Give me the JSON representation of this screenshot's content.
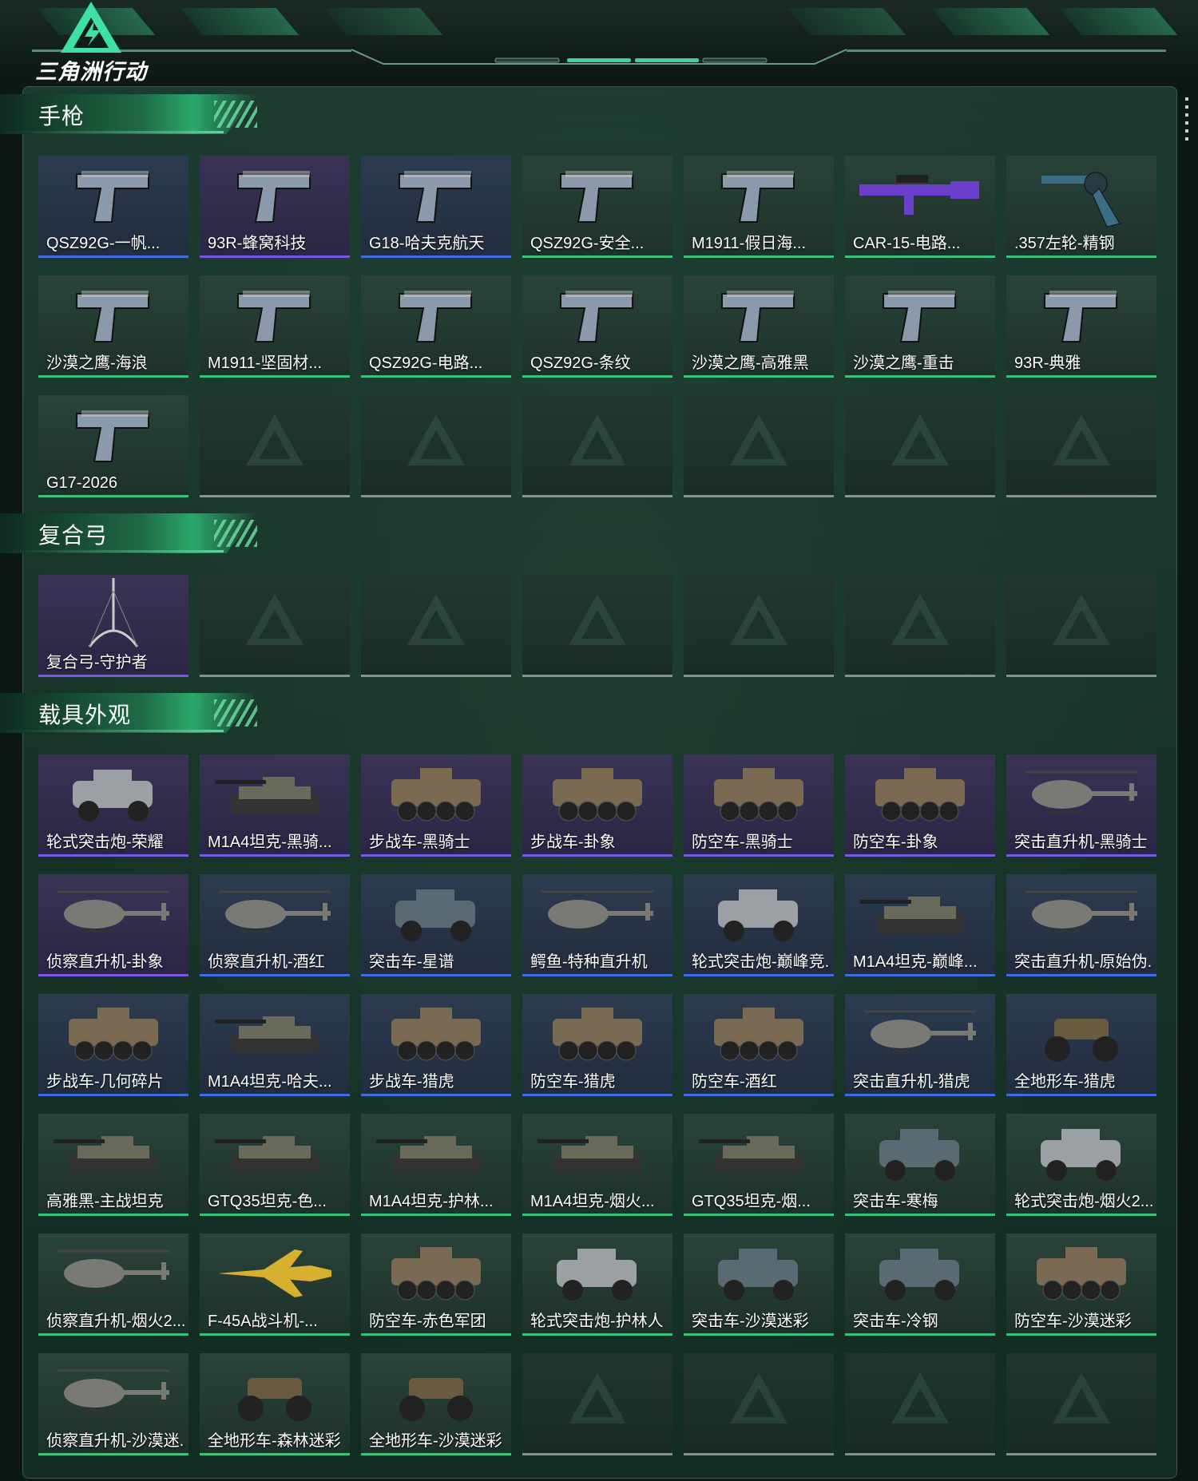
{
  "header": {
    "logo_text": "三角洲行动"
  },
  "colors": {
    "purple": "#7a56e6",
    "blue": "#3d6de0",
    "green": "#37c47a",
    "empty": "#9aa39f"
  },
  "sections": [
    {
      "title": "手枪",
      "items": [
        {
          "name": "QSZ92G-一帆...",
          "rarity": "blue",
          "icon": "pistol-icon"
        },
        {
          "name": "93R-蜂窝科技",
          "rarity": "purple",
          "icon": "pistol-icon"
        },
        {
          "name": "G18-哈夫克航天",
          "rarity": "blue",
          "icon": "pistol-icon"
        },
        {
          "name": "QSZ92G-安全...",
          "rarity": "green",
          "icon": "pistol-icon"
        },
        {
          "name": "M1911-假日海...",
          "rarity": "green",
          "icon": "pistol-icon"
        },
        {
          "name": "CAR-15-电路...",
          "rarity": "green",
          "icon": "rifle-icon"
        },
        {
          "name": ".357左轮-精钢",
          "rarity": "green",
          "icon": "revolver-icon"
        },
        {
          "name": "沙漠之鹰-海浪",
          "rarity": "green",
          "icon": "pistol-icon"
        },
        {
          "name": "M1911-坚固材...",
          "rarity": "green",
          "icon": "pistol-icon"
        },
        {
          "name": "QSZ92G-电路...",
          "rarity": "green",
          "icon": "pistol-icon"
        },
        {
          "name": "QSZ92G-条纹",
          "rarity": "green",
          "icon": "pistol-icon"
        },
        {
          "name": "沙漠之鹰-高雅黑",
          "rarity": "green",
          "icon": "pistol-icon"
        },
        {
          "name": "沙漠之鹰-重击",
          "rarity": "green",
          "icon": "pistol-icon"
        },
        {
          "name": "93R-典雅",
          "rarity": "green",
          "icon": "pistol-icon"
        },
        {
          "name": "G17-2026",
          "rarity": "green",
          "icon": "pistol-icon"
        },
        {
          "name": "",
          "rarity": "empty"
        },
        {
          "name": "",
          "rarity": "empty"
        },
        {
          "name": "",
          "rarity": "empty"
        },
        {
          "name": "",
          "rarity": "empty"
        },
        {
          "name": "",
          "rarity": "empty"
        },
        {
          "name": "",
          "rarity": "empty"
        }
      ]
    },
    {
      "title": "复合弓",
      "items": [
        {
          "name": "复合弓-守护者",
          "rarity": "purple",
          "icon": "bow-icon"
        },
        {
          "name": "",
          "rarity": "empty"
        },
        {
          "name": "",
          "rarity": "empty"
        },
        {
          "name": "",
          "rarity": "empty"
        },
        {
          "name": "",
          "rarity": "empty"
        },
        {
          "name": "",
          "rarity": "empty"
        },
        {
          "name": "",
          "rarity": "empty"
        }
      ]
    },
    {
      "title": "载具外观",
      "items": [
        {
          "name": "轮式突击炮-荣耀",
          "rarity": "purple",
          "icon": "buggy-icon"
        },
        {
          "name": "M1A4坦克-黑骑...",
          "rarity": "purple",
          "icon": "tank-icon"
        },
        {
          "name": "步战车-黑骑士",
          "rarity": "purple",
          "icon": "apc-icon"
        },
        {
          "name": "步战车-卦象",
          "rarity": "purple",
          "icon": "apc-icon"
        },
        {
          "name": "防空车-黑骑士",
          "rarity": "purple",
          "icon": "apc-icon"
        },
        {
          "name": "防空车-卦象",
          "rarity": "purple",
          "icon": "apc-icon"
        },
        {
          "name": "突击直升机-黑骑士",
          "rarity": "purple",
          "icon": "helicopter-icon"
        },
        {
          "name": "侦察直升机-卦象",
          "rarity": "purple",
          "icon": "helicopter-icon"
        },
        {
          "name": "侦察直升机-酒红",
          "rarity": "blue",
          "icon": "helicopter-icon"
        },
        {
          "name": "突击车-星谱",
          "rarity": "blue",
          "icon": "truck-icon"
        },
        {
          "name": "鳄鱼-特种直升机",
          "rarity": "blue",
          "icon": "helicopter-icon"
        },
        {
          "name": "轮式突击炮-巅峰竞...",
          "rarity": "blue",
          "icon": "buggy-icon"
        },
        {
          "name": "M1A4坦克-巅峰...",
          "rarity": "blue",
          "icon": "tank-icon"
        },
        {
          "name": "突击直升机-原始伪...",
          "rarity": "blue",
          "icon": "helicopter-icon"
        },
        {
          "name": "步战车-几何碎片",
          "rarity": "blue",
          "icon": "apc-icon"
        },
        {
          "name": "M1A4坦克-哈夫...",
          "rarity": "blue",
          "icon": "tank-icon"
        },
        {
          "name": "步战车-猎虎",
          "rarity": "blue",
          "icon": "apc-icon"
        },
        {
          "name": "防空车-猎虎",
          "rarity": "blue",
          "icon": "apc-icon"
        },
        {
          "name": "防空车-酒红",
          "rarity": "blue",
          "icon": "apc-icon"
        },
        {
          "name": "突击直升机-猎虎",
          "rarity": "blue",
          "icon": "helicopter-icon"
        },
        {
          "name": "全地形车-猎虎",
          "rarity": "blue",
          "icon": "atv-icon"
        },
        {
          "name": "高雅黑-主战坦克",
          "rarity": "green",
          "icon": "tank-icon"
        },
        {
          "name": "GTQ35坦克-色...",
          "rarity": "green",
          "icon": "tank-icon"
        },
        {
          "name": "M1A4坦克-护林...",
          "rarity": "green",
          "icon": "tank-icon"
        },
        {
          "name": "M1A4坦克-烟火...",
          "rarity": "green",
          "icon": "tank-icon"
        },
        {
          "name": "GTQ35坦克-烟...",
          "rarity": "green",
          "icon": "tank-icon"
        },
        {
          "name": "突击车-寒梅",
          "rarity": "green",
          "icon": "truck-icon"
        },
        {
          "name": "轮式突击炮-烟火2...",
          "rarity": "green",
          "icon": "buggy-icon"
        },
        {
          "name": "侦察直升机-烟火2...",
          "rarity": "green",
          "icon": "helicopter-icon"
        },
        {
          "name": "F-45A战斗机-...",
          "rarity": "green",
          "icon": "jet-icon"
        },
        {
          "name": "防空车-赤色军团",
          "rarity": "green",
          "icon": "apc-icon"
        },
        {
          "name": "轮式突击炮-护林人",
          "rarity": "green",
          "icon": "buggy-icon"
        },
        {
          "name": "突击车-沙漠迷彩",
          "rarity": "green",
          "icon": "truck-icon"
        },
        {
          "name": "突击车-冷钢",
          "rarity": "green",
          "icon": "truck-icon"
        },
        {
          "name": "防空车-沙漠迷彩",
          "rarity": "green",
          "icon": "apc-icon"
        },
        {
          "name": "侦察直升机-沙漠迷...",
          "rarity": "green",
          "icon": "helicopter-icon"
        },
        {
          "name": "全地形车-森林迷彩",
          "rarity": "green",
          "icon": "atv-icon"
        },
        {
          "name": "全地形车-沙漠迷彩",
          "rarity": "green",
          "icon": "atv-icon"
        },
        {
          "name": "",
          "rarity": "empty"
        },
        {
          "name": "",
          "rarity": "empty"
        },
        {
          "name": "",
          "rarity": "empty"
        },
        {
          "name": "",
          "rarity": "empty"
        }
      ]
    }
  ]
}
